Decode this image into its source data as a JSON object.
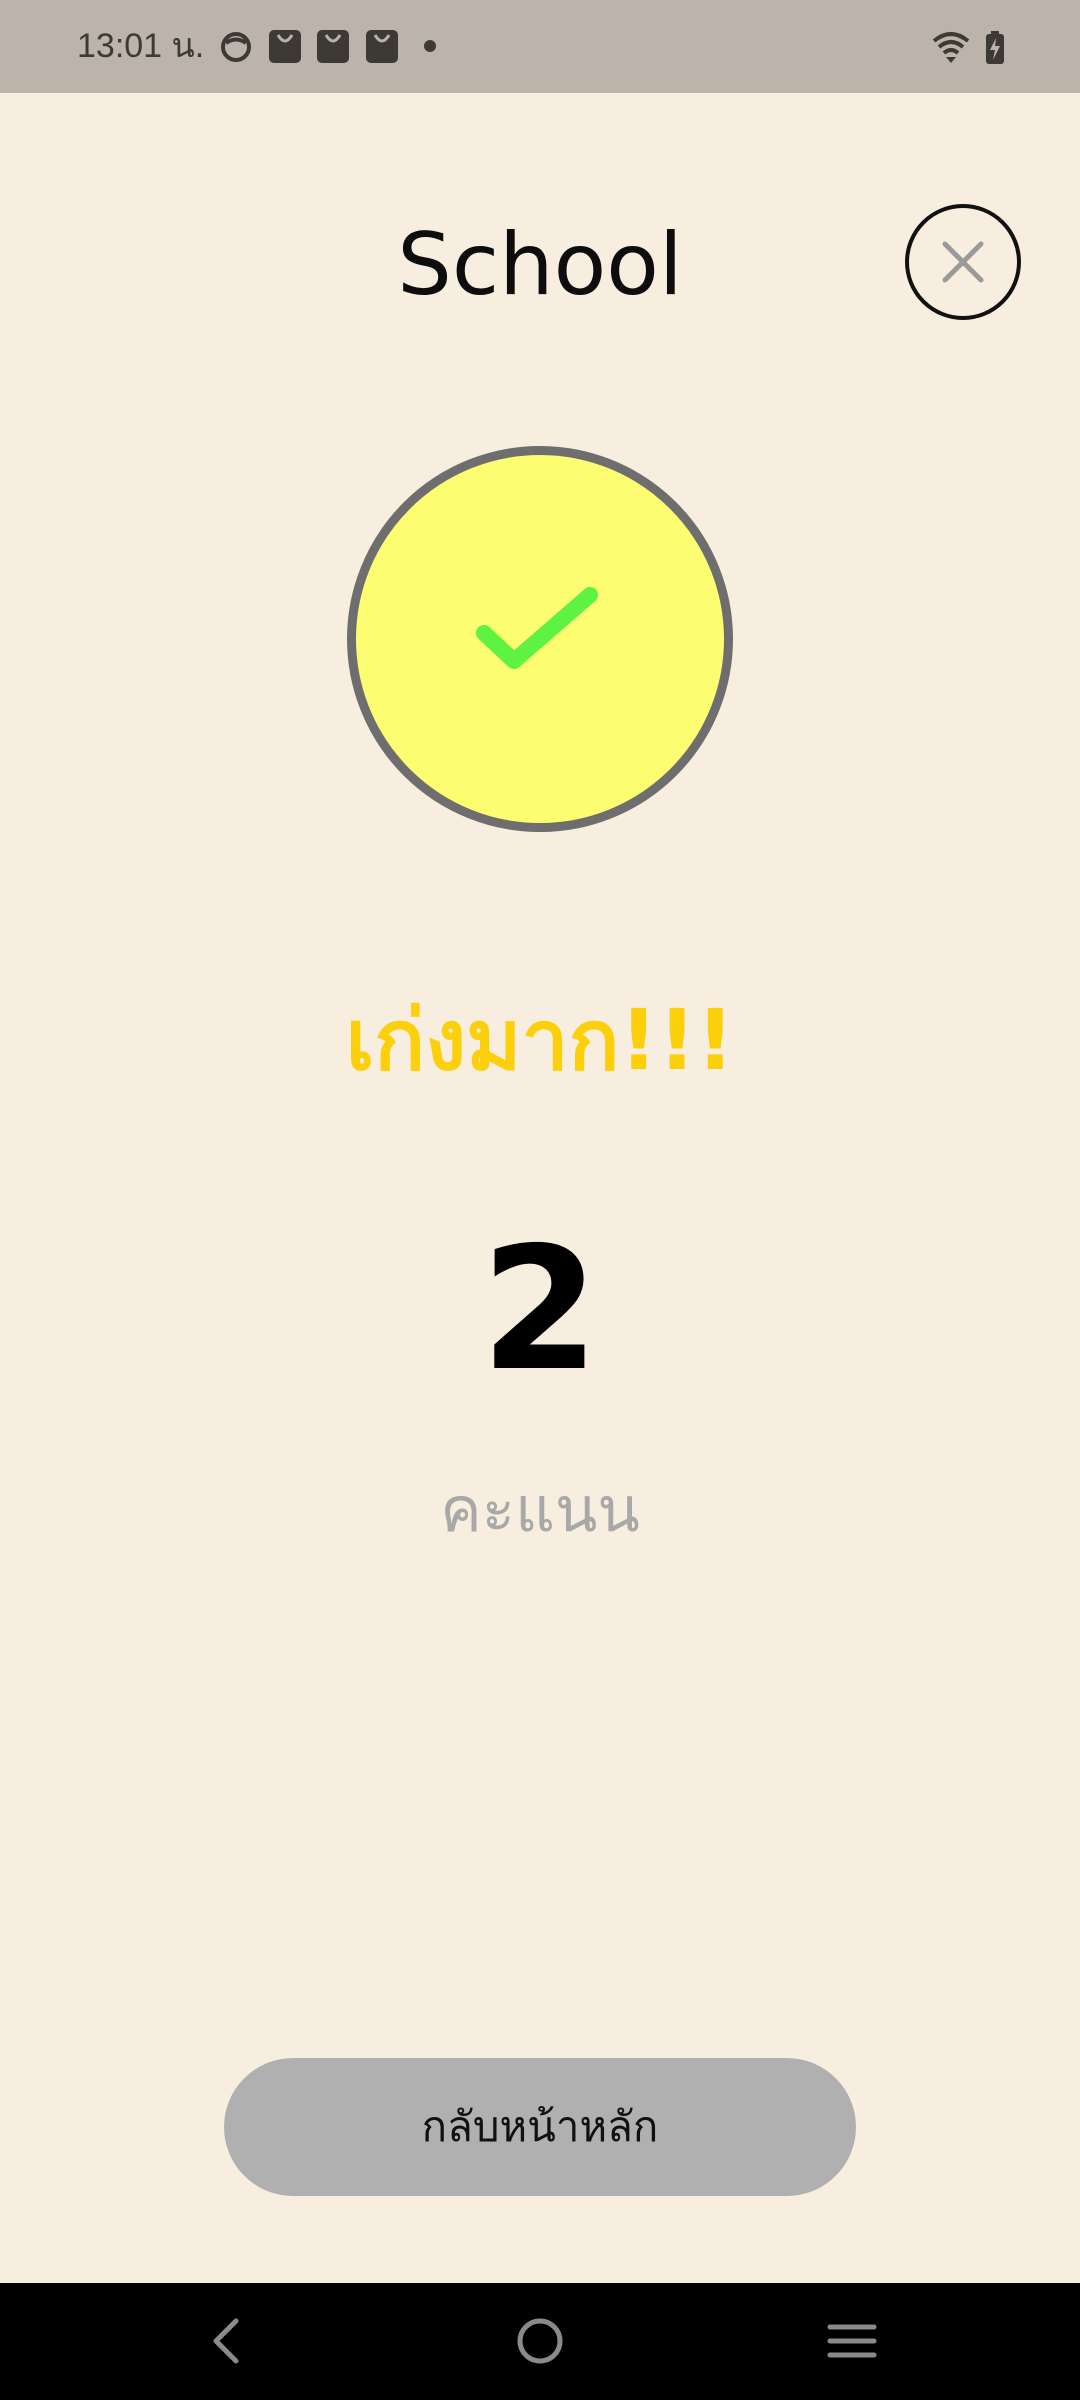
{
  "status_bar": {
    "time": "13:01 น.",
    "icons": [
      "face-icon",
      "shopping-bag-icon",
      "shopping-bag-icon",
      "shopping-bag-icon",
      "dot-icon",
      "wifi-icon",
      "battery-charging-icon"
    ]
  },
  "header": {
    "title": "School",
    "close_icon": "close-icon"
  },
  "result": {
    "icon": "checkmark-icon",
    "praise": "เก่งมาก!!!",
    "score": "2",
    "score_label": "คะแนน"
  },
  "actions": {
    "home_label": "กลับหน้าหลัก"
  },
  "nav_bar": {
    "items": [
      "back-icon",
      "home-icon",
      "recents-icon"
    ]
  },
  "colors": {
    "background": "#f8eedf",
    "status_bar": "#bcb4aa",
    "circle_fill": "#fdfd72",
    "circle_border": "#6e6e6e",
    "check": "#5ef243",
    "praise": "#fccf0b",
    "score_label": "#a8a8a8",
    "home_button": "#b0b0b0"
  }
}
